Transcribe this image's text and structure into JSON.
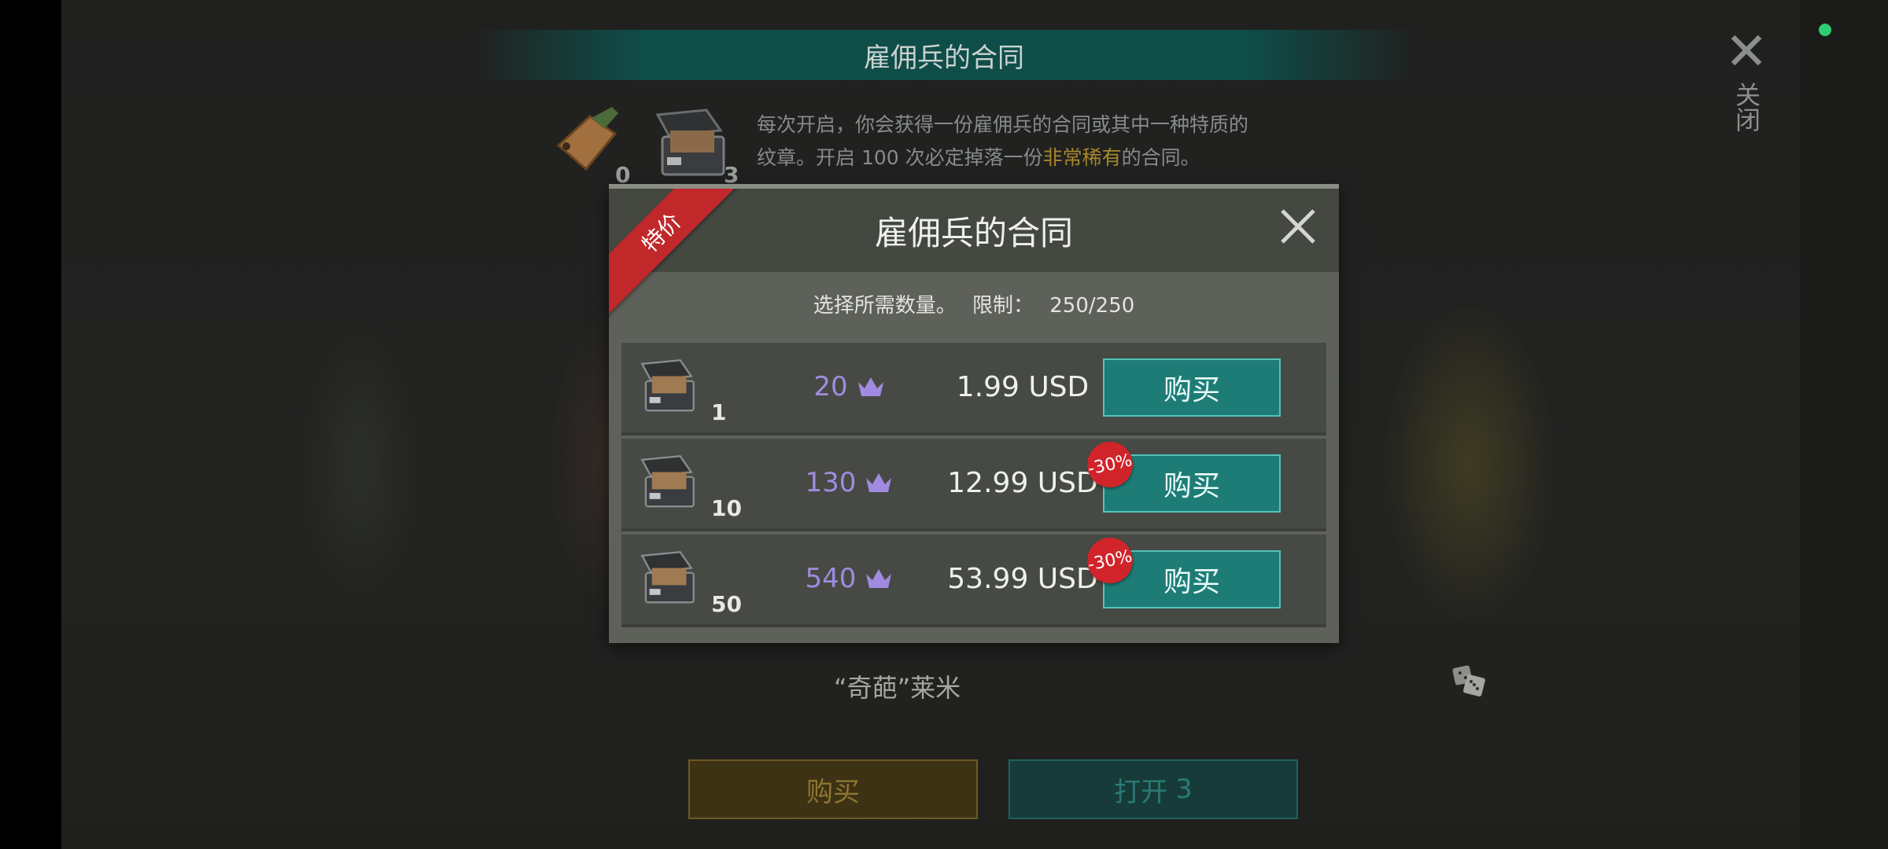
{
  "header": {
    "title": "雇佣兵的合同",
    "close_label": "关闭"
  },
  "inventory": {
    "tag_count": "0",
    "chest_count": "3"
  },
  "description": {
    "line1": "每次开启，你会获得一份雇佣兵的合同或其中一种特质的",
    "line2_prefix": "纹章。开启 100 次必定掉落一份",
    "line2_highlight": "非常稀有",
    "line2_suffix": "的合同。"
  },
  "character": {
    "name": "“奇葩”莱米"
  },
  "bottom_buttons": {
    "buy_label": "购买",
    "open_label": "打开",
    "open_count": "3"
  },
  "dialog": {
    "title": "雇佣兵的合同",
    "ribbon": "特价",
    "limit_prompt": "选择所需数量。",
    "limit_label": "限制：",
    "limit_value": "250/250",
    "rows": [
      {
        "qty": "1",
        "gold": "20",
        "price": "1.99 USD",
        "buy": "购买",
        "discount": ""
      },
      {
        "qty": "10",
        "gold": "130",
        "price": "12.99 USD",
        "buy": "购买",
        "discount": "-30%"
      },
      {
        "qty": "50",
        "gold": "540",
        "price": "53.99 USD",
        "buy": "购买",
        "discount": "-30%"
      }
    ]
  },
  "colors": {
    "accent_teal": "#1e7c76",
    "gold_text": "#a08be0",
    "ribbon_red": "#c0282a",
    "highlight": "#a5862b"
  }
}
